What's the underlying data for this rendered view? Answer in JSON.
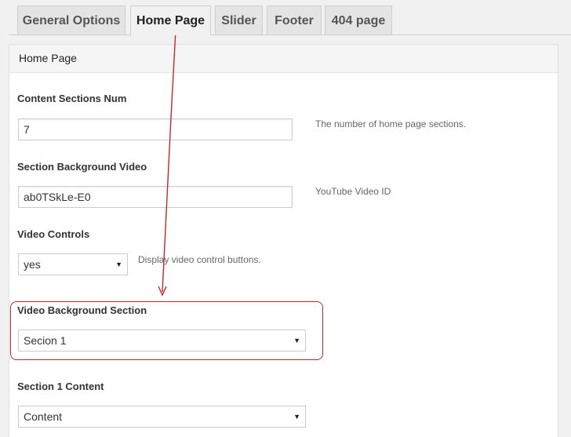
{
  "tabs": [
    {
      "label": "General Options",
      "active": false
    },
    {
      "label": "Home Page",
      "active": true
    },
    {
      "label": "Slider",
      "active": false
    },
    {
      "label": "Footer",
      "active": false
    },
    {
      "label": "404 page",
      "active": false
    }
  ],
  "panel": {
    "title": "Home Page",
    "fields": {
      "sections_num": {
        "label": "Content Sections Num",
        "value": "7",
        "description": "The number of home page sections."
      },
      "bg_video": {
        "label": "Section Background Video",
        "value": "ab0TSkLe-E0",
        "description": "YouTube Video ID"
      },
      "video_controls": {
        "label": "Video Controls",
        "value": "yes",
        "description": "Display video control buttons."
      },
      "video_bg_section": {
        "label": "Video Background Section",
        "value": "Secion 1"
      },
      "section1_content": {
        "label": "Section 1 Content",
        "value": "Content"
      }
    }
  },
  "icons": {
    "dropdown": "chevron-down-icon",
    "dropdown_glyph": "▼"
  },
  "colors": {
    "annotation": "#c9262c",
    "page_bg": "#f1f1f1",
    "panel_bg": "#ffffff"
  }
}
